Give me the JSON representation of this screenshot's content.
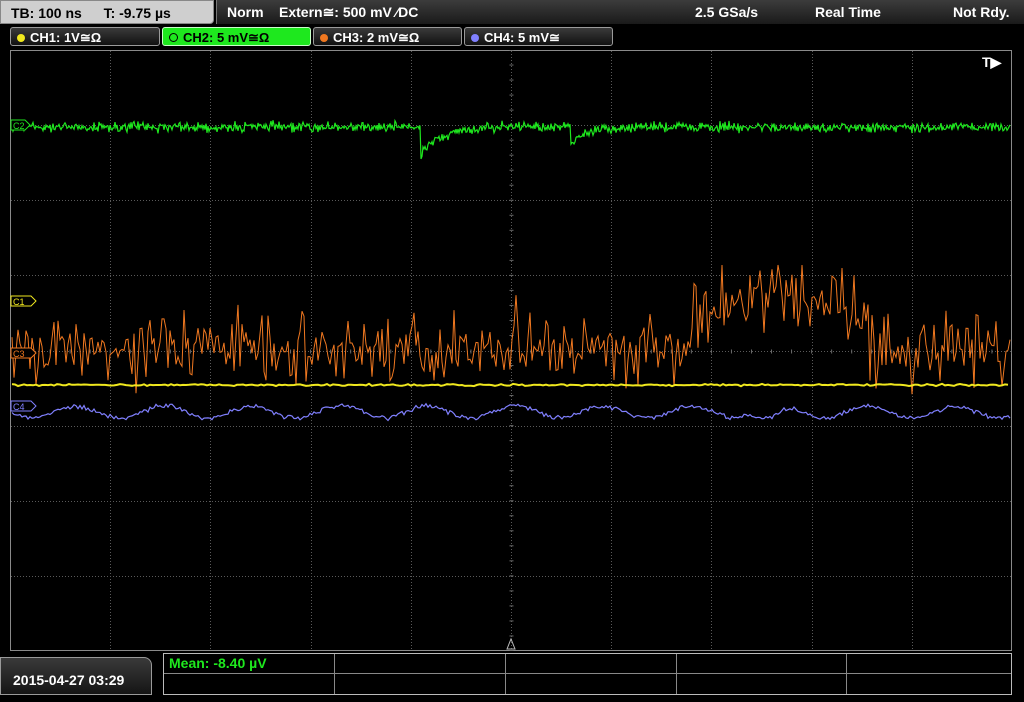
{
  "top": {
    "timebase": "TB: 100 ns",
    "trigger_time": "T: -9.75 µs",
    "mode": "Norm",
    "trigger_source": "Extern≅: 500 mV ⁄DC",
    "sample_rate": "2.5 GSa/s",
    "acquisition": "Real Time",
    "status": "Not Rdy."
  },
  "channels": [
    {
      "label": "CH1: 1V≅Ω",
      "color": "#f0e81e",
      "active": false
    },
    {
      "label": "CH2: 5 mV≅Ω",
      "color": "#1ee81e",
      "active": true
    },
    {
      "label": "CH3: 2 mV≅Ω",
      "color": "#f07820",
      "active": false
    },
    {
      "label": "CH4: 5 mV≅",
      "color": "#8080ff",
      "active": false
    }
  ],
  "markers": {
    "ch2": "C2",
    "ch1": "C1",
    "ch3": "C3",
    "ch4": "C4",
    "trigger": "T▶"
  },
  "colors": {
    "ch1": "#f0e81e",
    "ch2": "#1ee81e",
    "ch3": "#f07820",
    "ch4": "#8080ff",
    "grid": "#5a5a5a"
  },
  "bottom": {
    "datetime": "2015-04-27 03:29",
    "measurement": "Mean: -8.40 µV"
  }
}
